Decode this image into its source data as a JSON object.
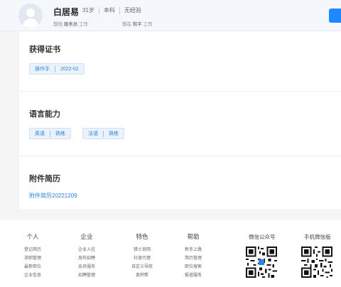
{
  "header": {
    "name": "白居易",
    "meta": [
      "31岁",
      "本科",
      "无经验"
    ],
    "sub_left": {
      "label": "想找",
      "value": "服务员",
      "suffix": "工作"
    },
    "sub_right": {
      "label": "想在",
      "value": "和平",
      "suffix": "工作"
    }
  },
  "sections": {
    "certificates": {
      "title": "获得证书",
      "items": [
        {
          "name": "操作手",
          "date": "2022-02"
        }
      ]
    },
    "languages": {
      "title": "语言能力",
      "items": [
        {
          "name": "英语",
          "level": "熟练"
        },
        {
          "name": "法语",
          "level": "熟练"
        }
      ]
    },
    "attachments": {
      "title": "附件简历",
      "link": "附件简历20221209"
    }
  },
  "footer": {
    "columns": [
      {
        "title": "个人",
        "items": [
          "登记简历",
          "求职管理",
          "最新职位",
          "企业信息"
        ]
      },
      {
        "title": "企业",
        "items": [
          "企业入驻",
          "发布招聘",
          "会员服务",
          "招聘管理"
        ]
      },
      {
        "title": "特色",
        "items": [
          "猎士官网",
          "社保代理",
          "自定义导航",
          "真积帮"
        ]
      },
      {
        "title": "帮助",
        "items": [
          "新手上路",
          "简历管理",
          "职位搜索",
          "报道服务"
        ]
      }
    ],
    "qr": [
      {
        "title": "微信公众号"
      },
      {
        "title": "手机微信版"
      }
    ]
  },
  "colors": {
    "accent": "#1e88ff",
    "tag_text": "#2d83e0",
    "tag_bg": "#eaf3fd"
  }
}
